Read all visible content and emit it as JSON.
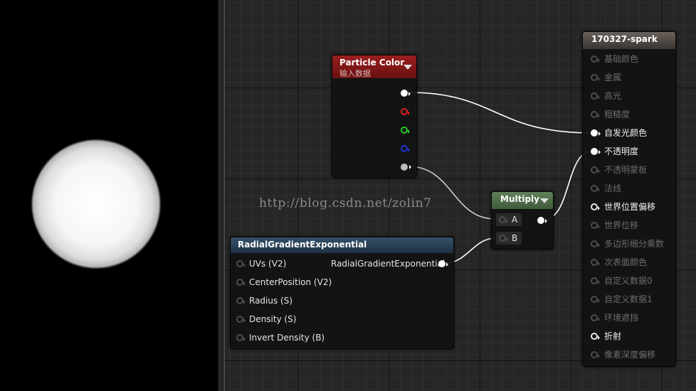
{
  "watermark": "http://blog.csdn.net/zolin7",
  "nodes": {
    "particle_color": {
      "title": "Particle Color",
      "subtitle": "输入数据",
      "header_color": "#7a1616"
    },
    "multiply": {
      "title": "Multiply",
      "inputs": [
        "A",
        "B"
      ],
      "header_color": "#4d6b48"
    },
    "radial": {
      "title": "RadialGradientExponential",
      "inputs": [
        "UVs (V2)",
        "CenterPosition (V2)",
        "Radius (S)",
        "Density (S)",
        "Invert Density (B)"
      ],
      "output": "RadialGradientExponential",
      "header_color": "#25384d"
    },
    "material": {
      "title": "170327-spark",
      "header_color": "#4a4440",
      "pins": [
        {
          "label": "基础颜色",
          "state": "disabled"
        },
        {
          "label": "金属",
          "state": "disabled"
        },
        {
          "label": "高光",
          "state": "disabled"
        },
        {
          "label": "粗糙度",
          "state": "disabled"
        },
        {
          "label": "自发光颜色",
          "state": "connected"
        },
        {
          "label": "不透明度",
          "state": "connected"
        },
        {
          "label": "不透明蒙板",
          "state": "disabled"
        },
        {
          "label": "法线",
          "state": "disabled"
        },
        {
          "label": "世界位置偏移",
          "state": "enabled"
        },
        {
          "label": "世界位移",
          "state": "disabled"
        },
        {
          "label": "多边形细分乘数",
          "state": "disabled"
        },
        {
          "label": "次表面颜色",
          "state": "disabled"
        },
        {
          "label": "自定义数据0",
          "state": "disabled"
        },
        {
          "label": "自定义数据1",
          "state": "disabled"
        },
        {
          "label": "环境遮挡",
          "state": "disabled"
        },
        {
          "label": "折射",
          "state": "enabled"
        },
        {
          "label": "像素深度偏移",
          "state": "disabled"
        }
      ]
    }
  }
}
